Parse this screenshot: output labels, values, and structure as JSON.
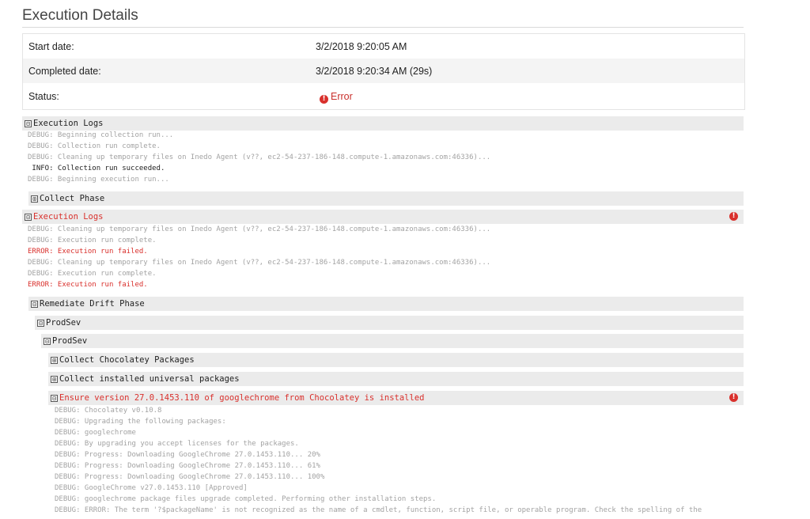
{
  "page": {
    "title": "Execution Details"
  },
  "details": {
    "start_label": "Start date:",
    "start_value": "3/2/2018 9:20:05 AM",
    "completed_label": "Completed date:",
    "completed_value": "3/2/2018 9:20:34 AM (29s)",
    "status_label": "Status:",
    "status_value": "Error"
  },
  "sections": {
    "exec_logs_1": "Execution Logs",
    "collect_phase": "Collect Phase",
    "exec_logs_2": "Execution Logs",
    "remediate": "Remediate Drift Phase",
    "prodsev_1": "ProdSev",
    "prodsev_2": "ProdSev",
    "collect_choco": "Collect Chocolatey Packages",
    "collect_universal": "Collect installed universal packages",
    "ensure": "Ensure version 27.0.1453.110 of googlechrome from Chocolatey is installed"
  },
  "logs1": [
    "DEBUG: Beginning collection run...",
    "DEBUG: Collection run complete.",
    "DEBUG: Cleaning up temporary files on Inedo Agent (v??, ec2-54-237-186-148.compute-1.amazonaws.com:46336)...",
    " INFO: Collection run succeeded.",
    "DEBUG: Beginning execution run..."
  ],
  "logs2": [
    "DEBUG: Cleaning up temporary files on Inedo Agent (v??, ec2-54-237-186-148.compute-1.amazonaws.com:46336)...",
    "DEBUG: Execution run complete.",
    "ERROR: Execution run failed.",
    "DEBUG: Cleaning up temporary files on Inedo Agent (v??, ec2-54-237-186-148.compute-1.amazonaws.com:46336)...",
    "DEBUG: Execution run complete.",
    "ERROR: Execution run failed."
  ],
  "logs3": [
    "DEBUG: Chocolatey v0.10.8",
    "DEBUG: Upgrading the following packages:",
    "DEBUG: googlechrome",
    "DEBUG: By upgrading you accept licenses for the packages.",
    "DEBUG: Progress: Downloading GoogleChrome 27.0.1453.110... 20%",
    "DEBUG: Progress: Downloading GoogleChrome 27.0.1453.110... 61%",
    "DEBUG: Progress: Downloading GoogleChrome 27.0.1453.110... 100%",
    "DEBUG: GoogleChrome v27.0.1453.110 [Approved]",
    "DEBUG: googlechrome package files upgrade completed. Performing other installation steps.",
    "DEBUG: ERROR: The term '?$packageName' is not recognized as the name of a cmdlet, function, script file, or operable program. Check the spelling of the"
  ],
  "icons": {
    "expanded": "⊟",
    "collapsed": "⊞",
    "error": "!"
  },
  "colors": {
    "error": "#d9302c",
    "header_bg": "#ebebeb",
    "debug_text": "#a3a3a3"
  }
}
